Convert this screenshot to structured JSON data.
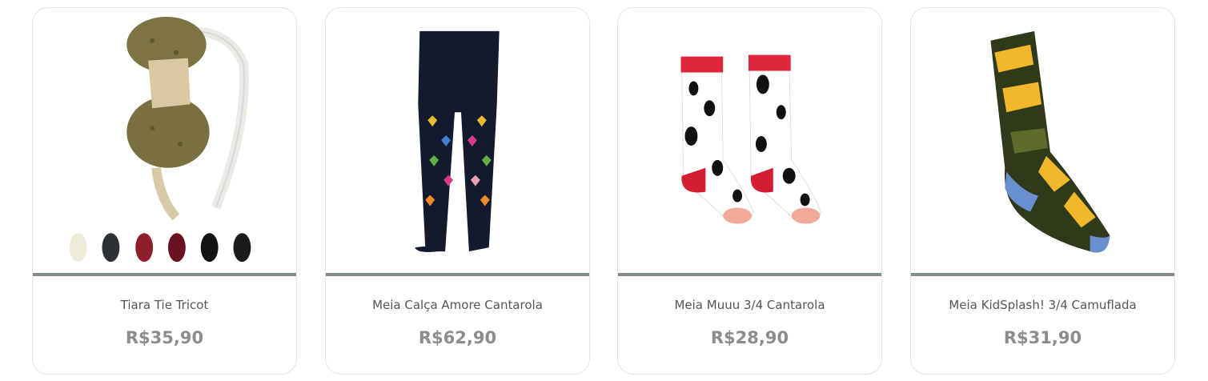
{
  "colors": {
    "divider": "#7f8c8a",
    "price": "#8c8c8c",
    "name": "#555555",
    "border": "#e4e4e4"
  },
  "products": [
    {
      "name": "Tiara Tie Tricot",
      "price": "R$35,90",
      "image": "knit-bow-headband-image"
    },
    {
      "name": "Meia Calça Amore Cantarola",
      "price": "R$62,90",
      "image": "heart-print-tights-image"
    },
    {
      "name": "Meia Muuu 3/4 Cantarola",
      "price": "R$28,90",
      "image": "cow-print-socks-image"
    },
    {
      "name": "Meia KidSplash! 3/4 Camuflada",
      "price": "R$31,90",
      "image": "camouflage-sock-image"
    }
  ]
}
